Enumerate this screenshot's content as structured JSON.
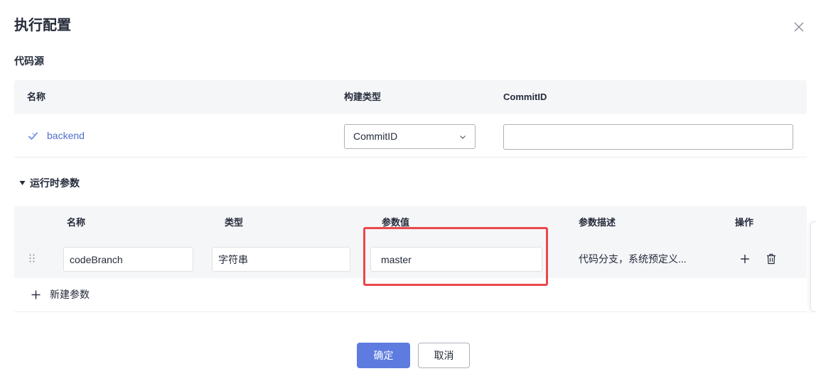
{
  "dialog": {
    "title": "执行配置",
    "close_icon": "close-icon"
  },
  "code_source": {
    "section_title": "代码源",
    "columns": [
      "名称",
      "构建类型",
      "CommitID"
    ],
    "rows": [
      {
        "icon": "check-icon",
        "name": "backend",
        "build_type": "CommitID",
        "build_type_icon": "chevron-down-icon",
        "commit_id": ""
      }
    ]
  },
  "runtime_params": {
    "toggle_icon": "caret-down-icon",
    "section_title": "运行时参数",
    "columns": [
      "名称",
      "类型",
      "参数值",
      "参数描述",
      "操作"
    ],
    "rows": [
      {
        "drag_icon": "drag-handle-icon",
        "name": "codeBranch",
        "type": "字符串",
        "value": "master",
        "description": "代码分支，系统预定义...",
        "actions": [
          "plus-icon",
          "trash-icon"
        ]
      }
    ],
    "add_icon": "plus-icon",
    "add_label": "新建参数"
  },
  "footer": {
    "confirm_label": "确定",
    "cancel_label": "取消"
  },
  "colors": {
    "primary": "#5e7ce0",
    "link": "#526ecc",
    "highlight": "#e8484b",
    "header_bg": "#f5f6f8",
    "text": "#252b3a"
  }
}
